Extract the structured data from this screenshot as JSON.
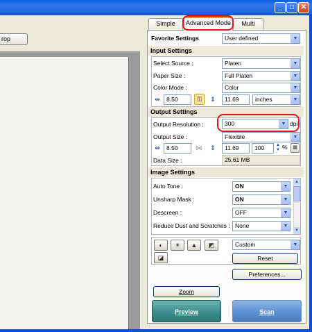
{
  "window": {
    "minimize": "_",
    "maximize": "□",
    "close": "✕"
  },
  "left": {
    "crop_label": "rop"
  },
  "tabs": [
    {
      "label": "Simple Mode"
    },
    {
      "label": "Advanced Mode"
    },
    {
      "label": "Multi Scan"
    }
  ],
  "favorite": {
    "label": "Favorite Settings",
    "value": "User defined"
  },
  "input": {
    "title": "Input Settings",
    "source_label": "Select Source :",
    "source_value": "Platen",
    "paper_label": "Paper Size :",
    "paper_value": "Full Platen",
    "color_label": "Color Mode :",
    "color_value": "Color",
    "width": "8.50",
    "height": "11.69",
    "unit": "inches"
  },
  "output": {
    "title": "Output Settings",
    "res_label": "Output Resolution :",
    "res_value": "300",
    "res_unit": "dpi",
    "size_label": "Output Size :",
    "size_value": "Flexible",
    "width": "8.50",
    "height": "11.69",
    "scale": "100",
    "scale_unit": "%",
    "data_label": "Data Size :",
    "data_value": "25.61 MB"
  },
  "image": {
    "title": "Image Settings",
    "rows": [
      {
        "label": "Auto Tone :",
        "value": "ON"
      },
      {
        "label": "Unsharp Mask :",
        "value": "ON"
      },
      {
        "label": "Descreen :",
        "value": "OFF"
      },
      {
        "label": "Reduce Dust and Scratches :",
        "value": "None"
      }
    ]
  },
  "tools": {
    "custom": "Custom",
    "reset": "Reset",
    "preferences": "Preferences..."
  },
  "buttons": {
    "zoom": "Zoom",
    "preview": "Preview",
    "scan": "Scan"
  },
  "colors": {
    "accent_ring": "#e0141a",
    "preview_button": "#3a8c8a",
    "scan_button": "#5a8fd0"
  }
}
